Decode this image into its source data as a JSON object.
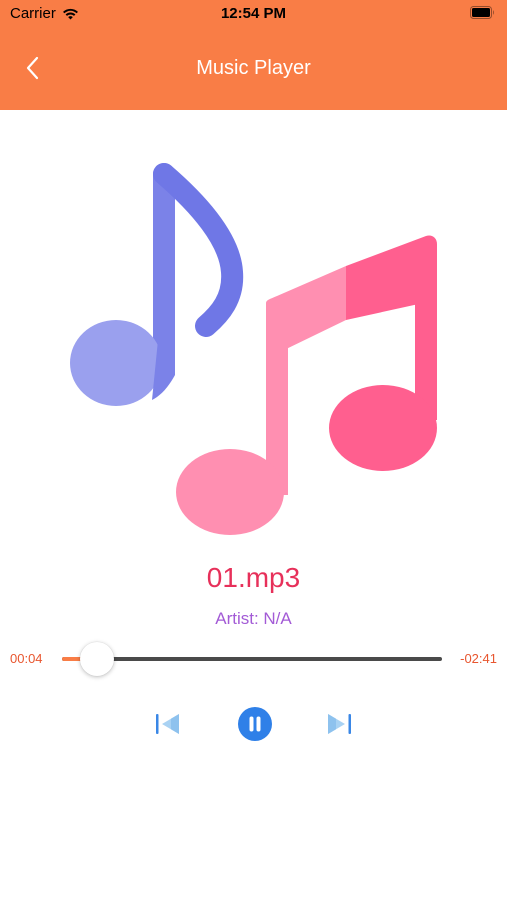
{
  "status_bar": {
    "carrier": "Carrier",
    "time": "12:54 PM"
  },
  "nav": {
    "title": "Music Player",
    "back_icon": "chevron-left-icon"
  },
  "artwork": {
    "icon": "music-notes-icon",
    "note_left_color": "#8e94ec",
    "note_right_color": "#ff6a98"
  },
  "track": {
    "title": "01.mp3",
    "artist": "Artist: N/A"
  },
  "progress": {
    "elapsed": "00:04",
    "remaining": "-02:41",
    "fraction": 0.024
  },
  "controls": {
    "prev_icon": "skip-previous-icon",
    "play_pause_icon": "pause-icon",
    "next_icon": "skip-next-icon"
  },
  "colors": {
    "header": "#f97d46",
    "title": "#e7305a",
    "artist": "#a35bd6",
    "time": "#e8562f",
    "accent": "#2f80e8"
  }
}
